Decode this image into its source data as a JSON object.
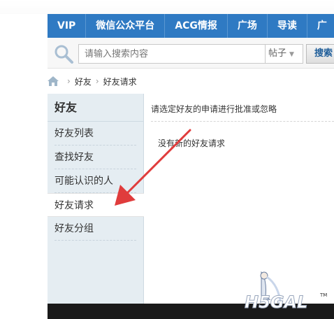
{
  "nav": {
    "items": [
      "VIP",
      "微信公众平台",
      "ACG情报",
      "广场",
      "导读",
      "广"
    ]
  },
  "search": {
    "placeholder": "请输入搜索内容",
    "type_label": "帖子",
    "button_label": "搜索"
  },
  "breadcrumb": {
    "items": [
      "好友",
      "好友请求"
    ]
  },
  "sidebar": {
    "title": "好友",
    "items": [
      {
        "label": "好友列表"
      },
      {
        "label": "查找好友"
      },
      {
        "label": "可能认识的人"
      },
      {
        "label": "好友请求"
      },
      {
        "label": "好友分组"
      }
    ]
  },
  "main": {
    "description": "请选定好友的申请进行批准或忽略",
    "empty_message": "没有新的好友请求"
  },
  "colors": {
    "nav_bg": "#2f7ac3",
    "sidebar_bg": "#e5edf2",
    "arrow": "#e03c3c"
  },
  "watermark": {
    "logo": "H5GAL",
    "mark": "TM"
  }
}
